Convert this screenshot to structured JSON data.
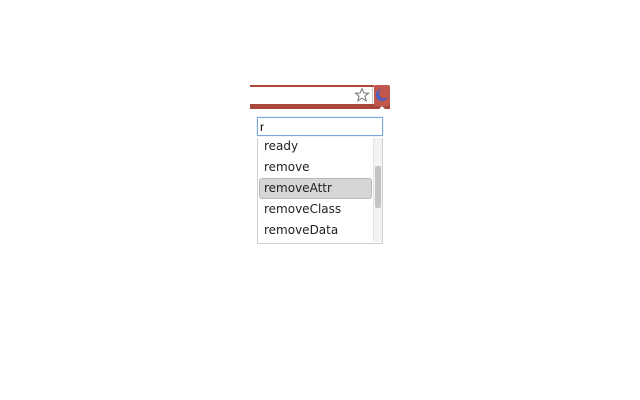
{
  "toolbar": {
    "star_icon": "star-outline-icon",
    "extension_icon": "crescent-moon-icon",
    "accent_color": "#b0483b"
  },
  "popup": {
    "search": {
      "value": "r",
      "placeholder": ""
    },
    "items": [
      {
        "label": "ready"
      },
      {
        "label": "remove"
      },
      {
        "label": "removeAttr"
      },
      {
        "label": "removeClass"
      },
      {
        "label": "removeData"
      }
    ],
    "selected_index": 2,
    "scroll_position": 0.3
  }
}
